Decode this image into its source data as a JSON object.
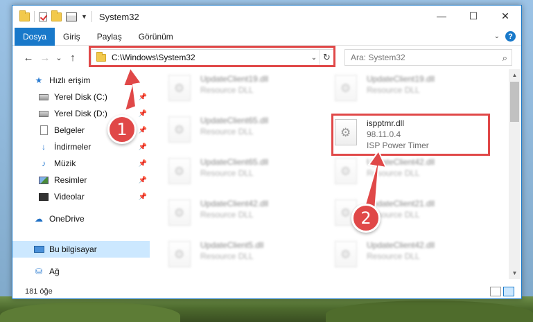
{
  "window": {
    "title": "System32",
    "controls": {
      "minimize": "—",
      "maximize": "☐",
      "close": "✕"
    }
  },
  "ribbon": {
    "tabs": [
      {
        "label": "Dosya",
        "active": true
      },
      {
        "label": "Giriş",
        "active": false
      },
      {
        "label": "Paylaş",
        "active": false
      },
      {
        "label": "Görünüm",
        "active": false
      }
    ]
  },
  "nav": {
    "back": "←",
    "forward": "→",
    "recent": "⌄",
    "up": "↑",
    "address": "C:\\Windows\\System32",
    "refresh": "↻",
    "search_placeholder": "Ara: System32",
    "search_icon": "⌕"
  },
  "sidebar": {
    "items": [
      {
        "label": "Hızlı erişim",
        "icon": "star-icon"
      },
      {
        "label": "Yerel Disk (C:)",
        "icon": "disk-icon",
        "pinned": true
      },
      {
        "label": "Yerel Disk (D:)",
        "icon": "disk-icon",
        "pinned": true
      },
      {
        "label": "Belgeler",
        "icon": "documents-icon",
        "pinned": true
      },
      {
        "label": "İndirmeler",
        "icon": "downloads-icon",
        "pinned": true
      },
      {
        "label": "Müzik",
        "icon": "music-icon",
        "pinned": true
      },
      {
        "label": "Resimler",
        "icon": "pictures-icon",
        "pinned": true
      },
      {
        "label": "Videolar",
        "icon": "videos-icon",
        "pinned": true
      },
      {
        "label": "OneDrive",
        "icon": "onedrive-icon"
      },
      {
        "label": "Bu bilgisayar",
        "icon": "this-pc-icon",
        "selected": true
      },
      {
        "label": "Ağ",
        "icon": "network-icon"
      }
    ]
  },
  "files": [
    {
      "name": "UpdateClient19.dll",
      "sub": "Resource DLL",
      "blurred": true
    },
    {
      "name": "UpdateClient19.dll",
      "sub": "Resource DLL",
      "blurred": true
    },
    {
      "name": "UpdateClient65.dll",
      "sub": "Resource DLL",
      "blurred": true
    },
    {
      "name": "ispptmr.dll",
      "version": "98.11.0.4",
      "sub": "ISP Power Timer",
      "blurred": false
    },
    {
      "name": "UpdateClient65.dll",
      "sub": "Resource DLL",
      "blurred": true
    },
    {
      "name": "UpdateClient42.dll",
      "sub": "Resource DLL",
      "blurred": true
    },
    {
      "name": "UpdateClient42.dll",
      "sub": "Resource DLL",
      "blurred": true
    },
    {
      "name": "UpdateClient21.dll",
      "sub": "Resource DLL",
      "blurred": true
    },
    {
      "name": "UpdateClient5.dll",
      "sub": "Resource DLL",
      "blurred": true
    },
    {
      "name": "UpdateClient42.dll",
      "sub": "Resource DLL",
      "blurred": true
    }
  ],
  "status": {
    "count": "181 öğe"
  },
  "annotations": {
    "badge1": "1",
    "badge2": "2",
    "color": "#e04848"
  }
}
